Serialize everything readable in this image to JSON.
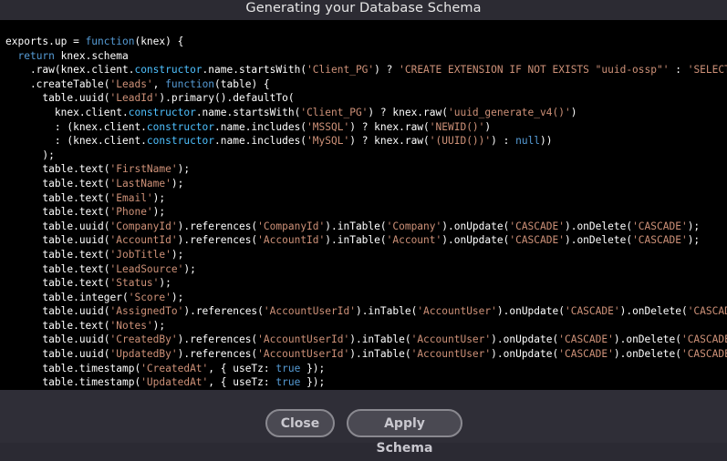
{
  "dialog": {
    "title": "Generating your Database Schema"
  },
  "code": {
    "language": "javascript",
    "lines": [
      [
        [
          "p",
          "exports.up = "
        ],
        [
          "k",
          "function"
        ],
        [
          "p",
          "(knex) {"
        ]
      ],
      [
        [
          "p",
          "  "
        ],
        [
          "k",
          "return"
        ],
        [
          "p",
          " knex.schema"
        ]
      ],
      [
        [
          "p",
          "    .raw(knex.client."
        ],
        [
          "c",
          "constructor"
        ],
        [
          "p",
          ".name.startsWith("
        ],
        [
          "s",
          "'Client_PG'"
        ],
        [
          "p",
          ") ? "
        ],
        [
          "s",
          "'CREATE EXTENSION IF NOT EXISTS \"uuid-ossp\"'"
        ],
        [
          "p",
          " : "
        ],
        [
          "s",
          "'SELECT"
        ]
      ],
      [
        [
          "p",
          "    .createTable("
        ],
        [
          "s",
          "'Leads'"
        ],
        [
          "p",
          ", "
        ],
        [
          "k",
          "function"
        ],
        [
          "p",
          "(table) {"
        ]
      ],
      [
        [
          "p",
          "      table.uuid("
        ],
        [
          "s",
          "'LeadId'"
        ],
        [
          "p",
          ").primary().defaultTo("
        ]
      ],
      [
        [
          "p",
          "        knex.client."
        ],
        [
          "c",
          "constructor"
        ],
        [
          "p",
          ".name.startsWith("
        ],
        [
          "s",
          "'Client_PG'"
        ],
        [
          "p",
          ") ? knex.raw("
        ],
        [
          "s",
          "'uuid_generate_v4()'"
        ],
        [
          "p",
          ")"
        ]
      ],
      [
        [
          "p",
          "        : (knex.client."
        ],
        [
          "c",
          "constructor"
        ],
        [
          "p",
          ".name.includes("
        ],
        [
          "s",
          "'MSSQL'"
        ],
        [
          "p",
          ") ? knex.raw("
        ],
        [
          "s",
          "'NEWID()'"
        ],
        [
          "p",
          ")"
        ]
      ],
      [
        [
          "p",
          "        : (knex.client."
        ],
        [
          "c",
          "constructor"
        ],
        [
          "p",
          ".name.includes("
        ],
        [
          "s",
          "'MySQL'"
        ],
        [
          "p",
          ") ? knex.raw("
        ],
        [
          "s",
          "'(UUID())'"
        ],
        [
          "p",
          ") : "
        ],
        [
          "k",
          "null"
        ],
        [
          "p",
          "))"
        ]
      ],
      [
        [
          "p",
          "      );"
        ]
      ],
      [
        [
          "p",
          "      table.text("
        ],
        [
          "s",
          "'FirstName'"
        ],
        [
          "p",
          ");"
        ]
      ],
      [
        [
          "p",
          "      table.text("
        ],
        [
          "s",
          "'LastName'"
        ],
        [
          "p",
          ");"
        ]
      ],
      [
        [
          "p",
          "      table.text("
        ],
        [
          "s",
          "'Email'"
        ],
        [
          "p",
          ");"
        ]
      ],
      [
        [
          "p",
          "      table.text("
        ],
        [
          "s",
          "'Phone'"
        ],
        [
          "p",
          ");"
        ]
      ],
      [
        [
          "p",
          "      table.uuid("
        ],
        [
          "s",
          "'CompanyId'"
        ],
        [
          "p",
          ").references("
        ],
        [
          "s",
          "'CompanyId'"
        ],
        [
          "p",
          ").inTable("
        ],
        [
          "s",
          "'Company'"
        ],
        [
          "p",
          ").onUpdate("
        ],
        [
          "s",
          "'CASCADE'"
        ],
        [
          "p",
          ").onDelete("
        ],
        [
          "s",
          "'CASCADE'"
        ],
        [
          "p",
          ");"
        ]
      ],
      [
        [
          "p",
          "      table.uuid("
        ],
        [
          "s",
          "'AccountId'"
        ],
        [
          "p",
          ").references("
        ],
        [
          "s",
          "'AccountId'"
        ],
        [
          "p",
          ").inTable("
        ],
        [
          "s",
          "'Account'"
        ],
        [
          "p",
          ").onUpdate("
        ],
        [
          "s",
          "'CASCADE'"
        ],
        [
          "p",
          ").onDelete("
        ],
        [
          "s",
          "'CASCADE'"
        ],
        [
          "p",
          ");"
        ]
      ],
      [
        [
          "p",
          "      table.text("
        ],
        [
          "s",
          "'JobTitle'"
        ],
        [
          "p",
          ");"
        ]
      ],
      [
        [
          "p",
          "      table.text("
        ],
        [
          "s",
          "'LeadSource'"
        ],
        [
          "p",
          ");"
        ]
      ],
      [
        [
          "p",
          "      table.text("
        ],
        [
          "s",
          "'Status'"
        ],
        [
          "p",
          ");"
        ]
      ],
      [
        [
          "p",
          "      table.integer("
        ],
        [
          "s",
          "'Score'"
        ],
        [
          "p",
          ");"
        ]
      ],
      [
        [
          "p",
          "      table.uuid("
        ],
        [
          "s",
          "'AssignedTo'"
        ],
        [
          "p",
          ").references("
        ],
        [
          "s",
          "'AccountUserId'"
        ],
        [
          "p",
          ").inTable("
        ],
        [
          "s",
          "'AccountUser'"
        ],
        [
          "p",
          ").onUpdate("
        ],
        [
          "s",
          "'CASCADE'"
        ],
        [
          "p",
          ").onDelete("
        ],
        [
          "s",
          "'CASCADE"
        ]
      ],
      [
        [
          "p",
          "      table.text("
        ],
        [
          "s",
          "'Notes'"
        ],
        [
          "p",
          ");"
        ]
      ],
      [
        [
          "p",
          "      table.uuid("
        ],
        [
          "s",
          "'CreatedBy'"
        ],
        [
          "p",
          ").references("
        ],
        [
          "s",
          "'AccountUserId'"
        ],
        [
          "p",
          ").inTable("
        ],
        [
          "s",
          "'AccountUser'"
        ],
        [
          "p",
          ").onUpdate("
        ],
        [
          "s",
          "'CASCADE'"
        ],
        [
          "p",
          ").onDelete("
        ],
        [
          "s",
          "'CASCADE'"
        ]
      ],
      [
        [
          "p",
          "      table.uuid("
        ],
        [
          "s",
          "'UpdatedBy'"
        ],
        [
          "p",
          ").references("
        ],
        [
          "s",
          "'AccountUserId'"
        ],
        [
          "p",
          ").inTable("
        ],
        [
          "s",
          "'AccountUser'"
        ],
        [
          "p",
          ").onUpdate("
        ],
        [
          "s",
          "'CASCADE'"
        ],
        [
          "p",
          ").onDelete("
        ],
        [
          "s",
          "'CASCADE'"
        ]
      ],
      [
        [
          "p",
          "      table.timestamp("
        ],
        [
          "s",
          "'CreatedAt'"
        ],
        [
          "p",
          ", { useTz: "
        ],
        [
          "k",
          "true"
        ],
        [
          "p",
          " });"
        ]
      ],
      [
        [
          "p",
          "      table.timestamp("
        ],
        [
          "s",
          "'UpdatedAt'"
        ],
        [
          "p",
          ", { useTz: "
        ],
        [
          "k",
          "true"
        ],
        [
          "p",
          " });"
        ]
      ]
    ]
  },
  "buttons": {
    "close_label": "Close",
    "apply_label": "Apply Schema"
  },
  "colors": {
    "background": "#2f2e37",
    "code_background": "#000000",
    "code_text": "#ffffff",
    "keyword": "#569cd6",
    "string": "#ce9178",
    "property": "#4fc1ff",
    "button_border": "#8a8990",
    "button_text": "#c9c8cf"
  }
}
